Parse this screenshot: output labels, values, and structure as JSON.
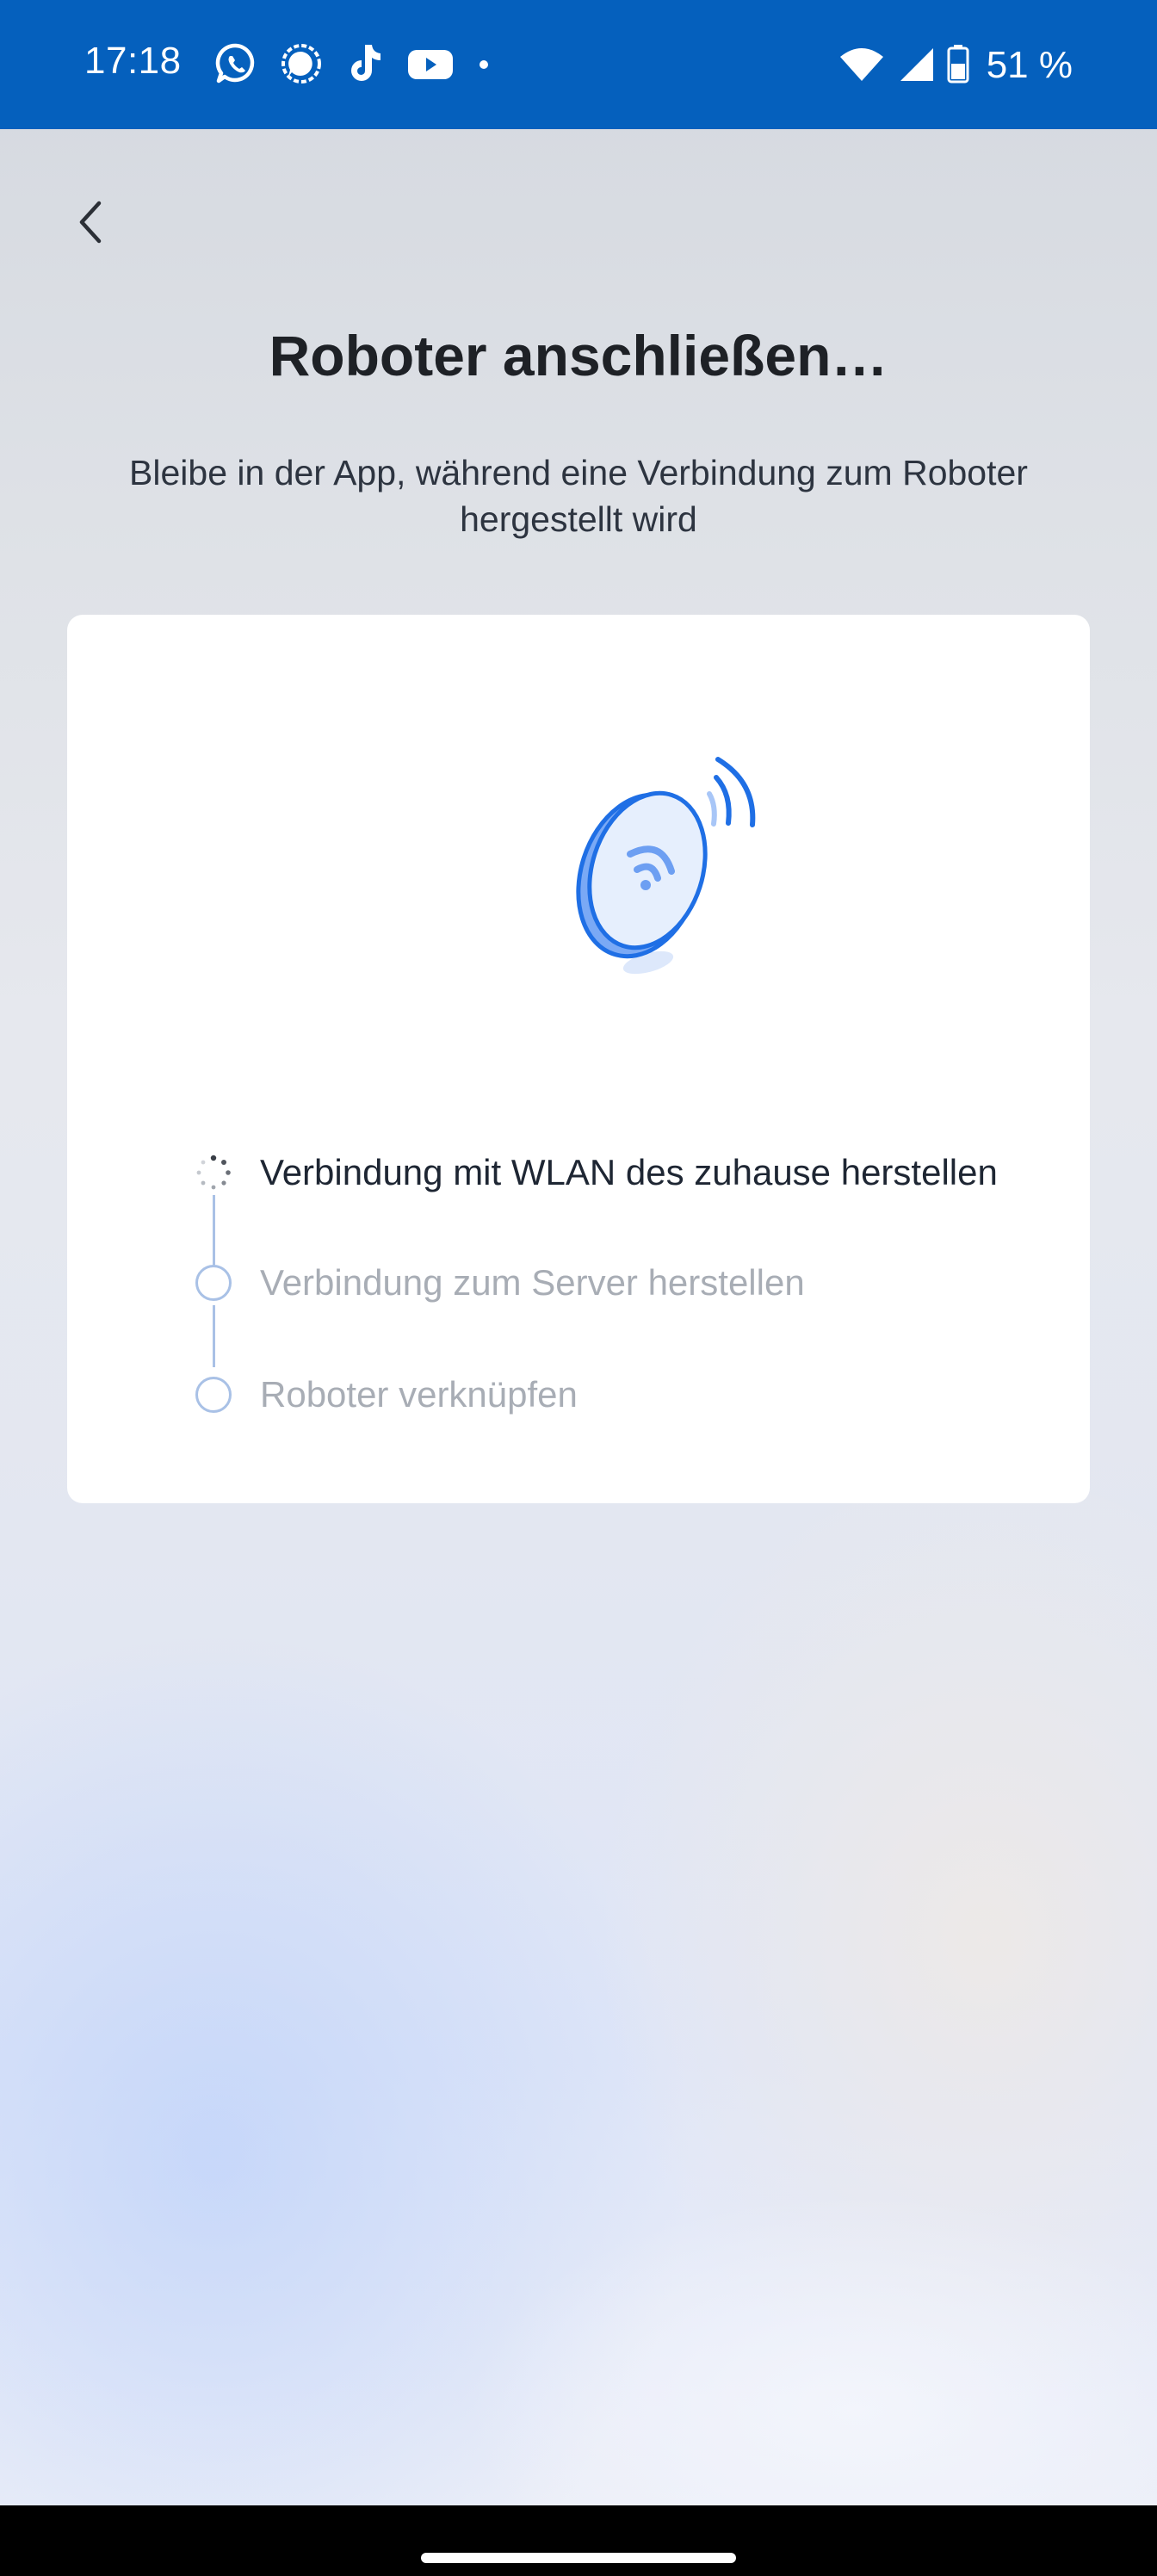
{
  "status_bar": {
    "time": "17:18",
    "notification_icons": [
      "whatsapp-icon",
      "signal-icon",
      "tiktok-icon",
      "youtube-icon",
      "more-dot-icon"
    ],
    "battery_text": "51 %",
    "color": "#0560bd"
  },
  "header": {
    "back_icon": "chevron-left-icon",
    "title": "Roboter anschließen…",
    "subtitle": "Bleibe in der App, während eine Verbindung zum Roboter hergestellt wird"
  },
  "card": {
    "illustration_icon": "robot-wifi-signal-icon",
    "steps": [
      {
        "label": "Verbindung mit WLAN des zuhause herstellen",
        "state": "in-progress"
      },
      {
        "label": "Verbindung zum Server herstellen",
        "state": "pending"
      },
      {
        "label": "Roboter verknüpfen",
        "state": "pending"
      }
    ]
  },
  "colors": {
    "accent": "#1f6fe5",
    "step_line": "#a9c1e6",
    "active_text": "#1e2633",
    "pending_text": "#a8adb5"
  }
}
